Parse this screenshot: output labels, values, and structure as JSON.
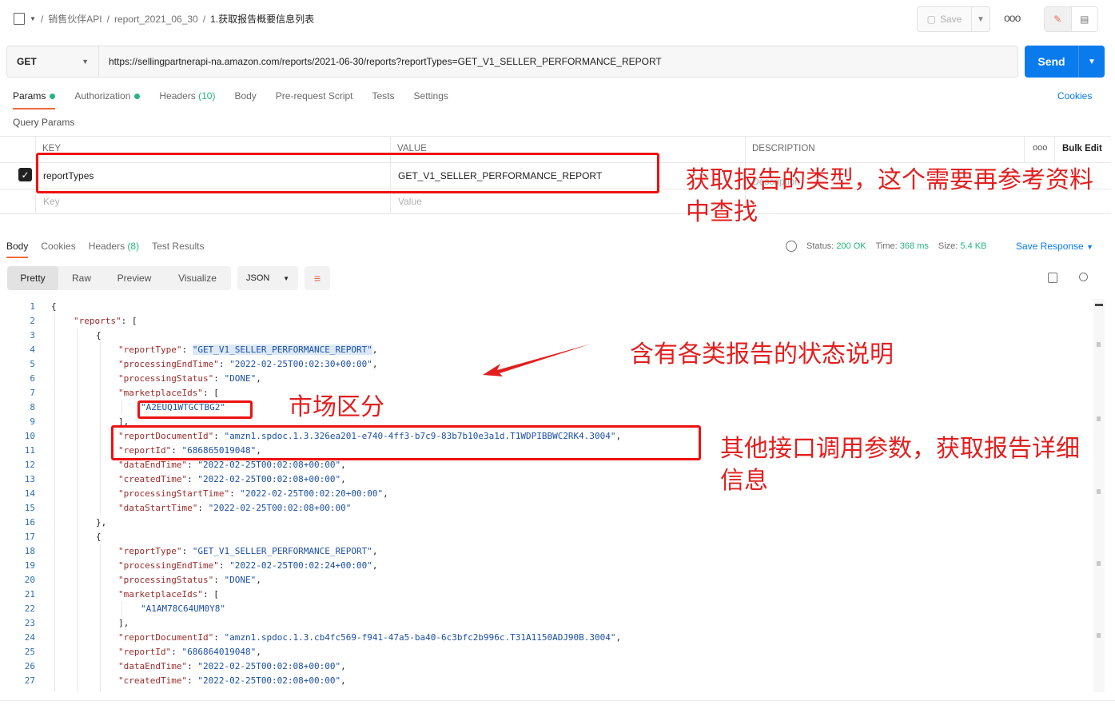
{
  "breadcrumb": {
    "part1": "销售伙伴API",
    "sep": "/",
    "part2": "report_2021_06_30",
    "part3": "1.获取报告概要信息列表"
  },
  "toolbar": {
    "save_label": "Save"
  },
  "request": {
    "method": "GET",
    "url": "https://sellingpartnerapi-na.amazon.com/reports/2021-06-30/reports?reportTypes=GET_V1_SELLER_PERFORMANCE_REPORT",
    "send_label": "Send"
  },
  "tabs": {
    "params": "Params",
    "authorization": "Authorization",
    "headers": "Headers",
    "headers_count": "(10)",
    "body": "Body",
    "prerequest": "Pre-request Script",
    "tests": "Tests",
    "settings": "Settings",
    "cookies": "Cookies"
  },
  "query_params": {
    "title": "Query Params",
    "headers": {
      "key": "KEY",
      "value": "VALUE",
      "description": "DESCRIPTION",
      "bulk_edit": "Bulk Edit"
    },
    "row": {
      "key": "reportTypes",
      "value": "GET_V1_SELLER_PERFORMANCE_REPORT"
    },
    "placeholders": {
      "key": "Key",
      "value": "Value",
      "description": "Description"
    }
  },
  "response": {
    "tabs": {
      "body": "Body",
      "cookies": "Cookies",
      "headers": "Headers",
      "headers_count": "(8)",
      "test_results": "Test Results"
    },
    "status_label": "Status:",
    "status_value": "200 OK",
    "time_label": "Time:",
    "time_value": "368 ms",
    "size_label": "Size:",
    "size_value": "5.4 KB",
    "save_response": "Save Response",
    "views": [
      "Pretty",
      "Raw",
      "Preview",
      "Visualize"
    ],
    "format": "JSON"
  },
  "code_lines": [
    {
      "n": "1",
      "t": "{"
    },
    {
      "n": "2",
      "k": "\"reports\"",
      "r": ": ["
    },
    {
      "n": "3",
      "t": "{"
    },
    {
      "n": "4",
      "k": "\"reportType\"",
      "m": ": ",
      "s": "\"GET_V1_SELLER_PERFORMANCE_REPORT\"",
      "r": ","
    },
    {
      "n": "5",
      "k": "\"processingEndTime\"",
      "m": ": ",
      "s": "\"2022-02-25T00:02:30+00:00\"",
      "r": ","
    },
    {
      "n": "6",
      "k": "\"processingStatus\"",
      "m": ": ",
      "s": "\"DONE\"",
      "r": ","
    },
    {
      "n": "7",
      "k": "\"marketplaceIds\"",
      "r": ": ["
    },
    {
      "n": "8",
      "s": "\"A2EUQ1WTGCTBG2\""
    },
    {
      "n": "9",
      "t": "],"
    },
    {
      "n": "10",
      "k": "\"reportDocumentId\"",
      "m": ": ",
      "s": "\"amzn1.spdoc.1.3.326ea201-e740-4ff3-b7c9-83b7b10e3a1d.T1WDPIBBWC2RK4.3004\"",
      "r": ","
    },
    {
      "n": "11",
      "k": "\"reportId\"",
      "m": ": ",
      "s": "\"686865019048\"",
      "r": ","
    },
    {
      "n": "12",
      "k": "\"dataEndTime\"",
      "m": ": ",
      "s": "\"2022-02-25T00:02:08+00:00\"",
      "r": ","
    },
    {
      "n": "13",
      "k": "\"createdTime\"",
      "m": ": ",
      "s": "\"2022-02-25T00:02:08+00:00\"",
      "r": ","
    },
    {
      "n": "14",
      "k": "\"processingStartTime\"",
      "m": ": ",
      "s": "\"2022-02-25T00:02:20+00:00\"",
      "r": ","
    },
    {
      "n": "15",
      "k": "\"dataStartTime\"",
      "m": ": ",
      "s": "\"2022-02-25T00:02:08+00:00\""
    },
    {
      "n": "16",
      "t": "},"
    },
    {
      "n": "17",
      "t": "{"
    },
    {
      "n": "18",
      "k": "\"reportType\"",
      "m": ": ",
      "s": "\"GET_V1_SELLER_PERFORMANCE_REPORT\"",
      "r": ","
    },
    {
      "n": "19",
      "k": "\"processingEndTime\"",
      "m": ": ",
      "s": "\"2022-02-25T00:02:24+00:00\"",
      "r": ","
    },
    {
      "n": "20",
      "k": "\"processingStatus\"",
      "m": ": ",
      "s": "\"DONE\"",
      "r": ","
    },
    {
      "n": "21",
      "k": "\"marketplaceIds\"",
      "r": ": ["
    },
    {
      "n": "22",
      "s": "\"A1AM78C64UM0Y8\""
    },
    {
      "n": "23",
      "t": "],"
    },
    {
      "n": "24",
      "k": "\"reportDocumentId\"",
      "m": ": ",
      "s": "\"amzn1.spdoc.1.3.cb4fc569-f941-47a5-ba40-6c3bfc2b996c.T31A1150ADJ90B.3004\"",
      "r": ","
    },
    {
      "n": "25",
      "k": "\"reportId\"",
      "m": ": ",
      "s": "\"686864019048\"",
      "r": ","
    },
    {
      "n": "26",
      "k": "\"dataEndTime\"",
      "m": ": ",
      "s": "\"2022-02-25T00:02:08+00:00\"",
      "r": ","
    },
    {
      "n": "27",
      "k": "\"createdTime\"",
      "m": ": ",
      "s": "\"2022-02-25T00:02:08+00:00\"",
      "r": ","
    }
  ],
  "annotations": {
    "report_type_note": "获取报告的类型，这个需要再参考资料中查找",
    "status_note": "含有各类报告的状态说明",
    "market_note": "市场区分",
    "params_note": "其他接口调用参数，获取报告详细信息"
  },
  "colors": {
    "accent": "#097bed",
    "active_tab": "#f26b3a",
    "success": "#26b47f",
    "annotation": "#e11f1f"
  }
}
